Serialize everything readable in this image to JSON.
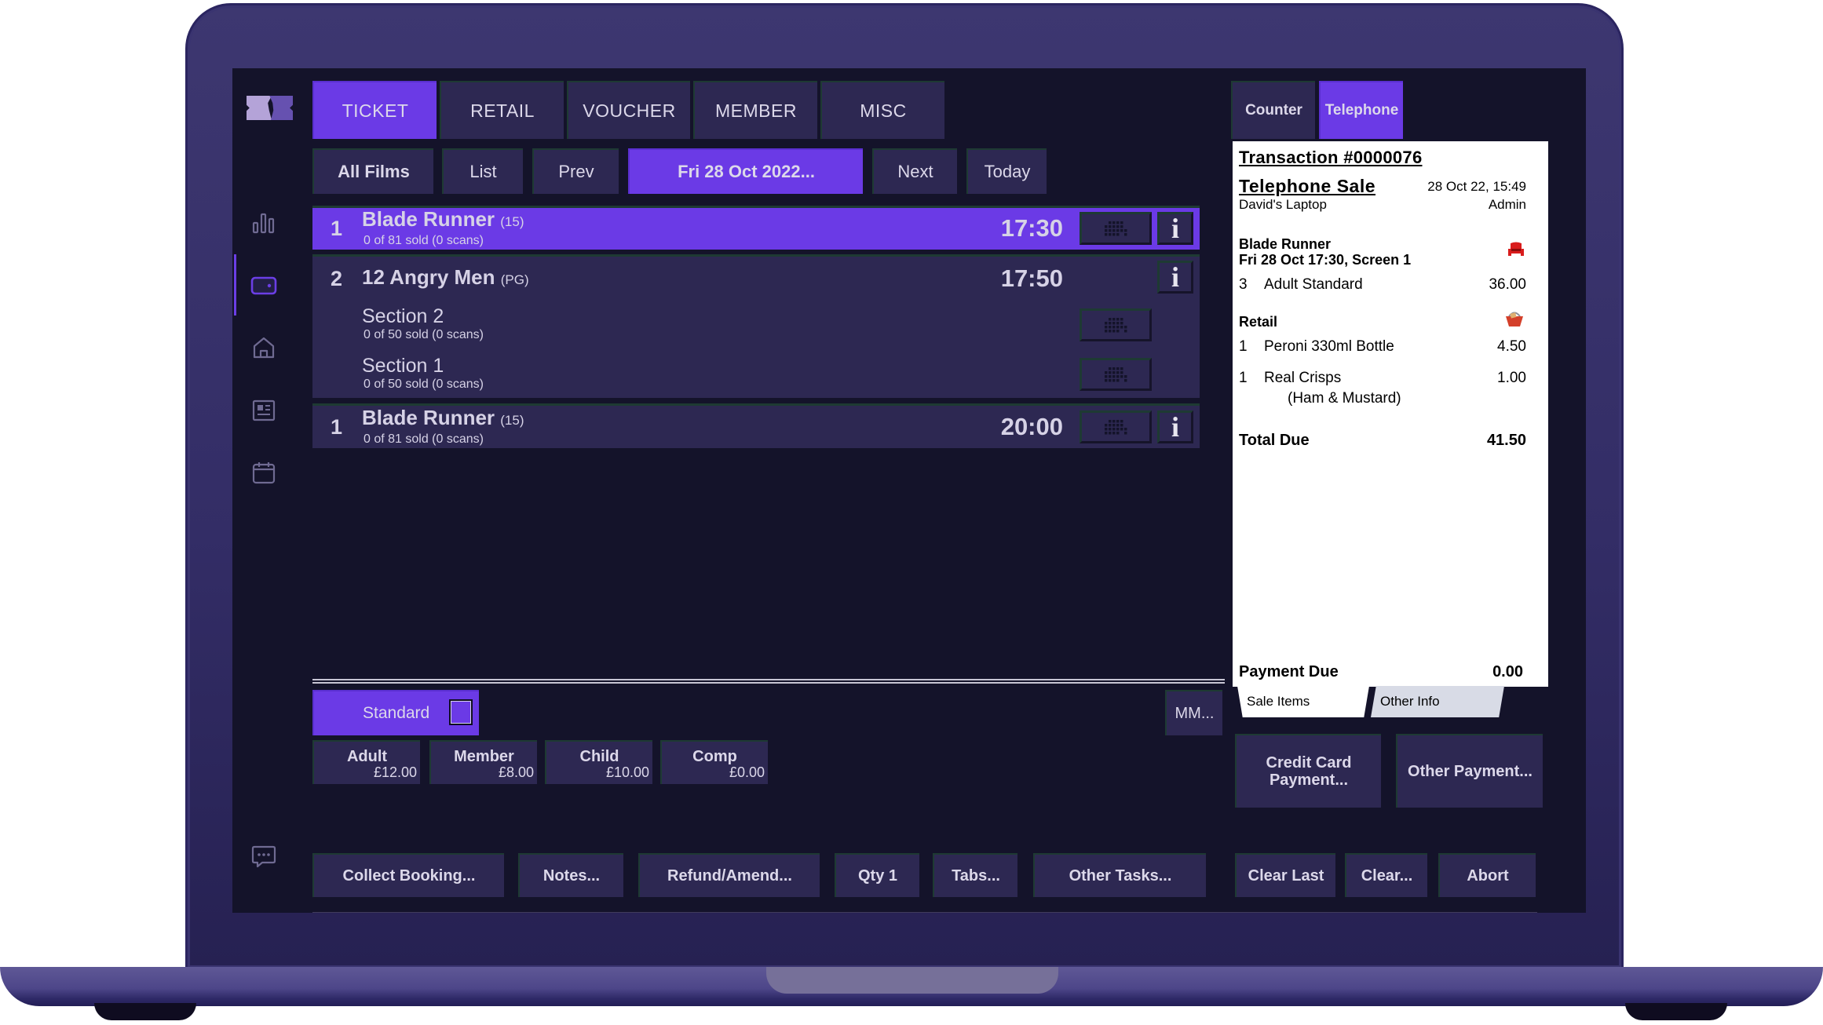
{
  "app": {
    "logo_name": "ticketing-logo"
  },
  "tabs": [
    {
      "label": "TICKET",
      "active": true
    },
    {
      "label": "RETAIL",
      "active": false
    },
    {
      "label": "VOUCHER",
      "active": false
    },
    {
      "label": "MEMBER",
      "active": false
    },
    {
      "label": "MISC",
      "active": false
    }
  ],
  "nav": {
    "all_films": "All Films",
    "list": "List",
    "prev": "Prev",
    "date": "Fri 28 Oct 2022...",
    "next": "Next",
    "today": "Today"
  },
  "sidebar": {
    "items": [
      {
        "icon": "bar-chart-icon",
        "active": false
      },
      {
        "icon": "ticket-card-icon",
        "active": true
      },
      {
        "icon": "home-icon",
        "active": false
      },
      {
        "icon": "newspaper-icon",
        "active": false
      },
      {
        "icon": "calendar-icon",
        "active": false
      }
    ],
    "chat_icon": "chat-bubble-icon"
  },
  "showtimes": [
    {
      "screen": "1",
      "title": "Blade Runner",
      "rating": "(15)",
      "sold": "0 of 81 sold (0 scans)",
      "time": "17:30",
      "selected": true
    },
    {
      "screen": "2",
      "title": "12 Angry Men",
      "rating": "(PG)",
      "time": "17:50",
      "selected": false,
      "sections": [
        {
          "name": "Section 2",
          "sold": "0 of 50 sold (0 scans)"
        },
        {
          "name": "Section 1",
          "sold": "0 of 50 sold (0 scans)"
        }
      ]
    },
    {
      "screen": "1",
      "title": "Blade Runner",
      "rating": "(15)",
      "sold": "0 of 81 sold (0 scans)",
      "time": "20:00",
      "selected": false
    }
  ],
  "info_label": "i",
  "seat_type": {
    "label": "Standard"
  },
  "mm_button": "MM...",
  "prices": [
    {
      "name": "Adult",
      "price": "£12.00"
    },
    {
      "name": "Member",
      "price": "£8.00"
    },
    {
      "name": "Child",
      "price": "£10.00"
    },
    {
      "name": "Comp",
      "price": "£0.00"
    }
  ],
  "bottom_buttons": {
    "collect_booking": "Collect Booking...",
    "notes": "Notes...",
    "refund_amend": "Refund/Amend...",
    "qty": "Qty 1",
    "tabs": "Tabs...",
    "other_tasks": "Other Tasks...",
    "clear_last": "Clear Last",
    "clear": "Clear...",
    "abort": "Abort"
  },
  "sale_mode": {
    "counter": "Counter",
    "telephone": "Telephone",
    "active": "Telephone"
  },
  "receipt": {
    "transaction": "Transaction #0000076",
    "sale_type": "Telephone Sale",
    "datetime": "28 Oct 22, 15:49",
    "terminal": "David's Laptop",
    "user": "Admin",
    "ticket_section": {
      "film": "Blade Runner",
      "showing": "Fri 28 Oct 17:30, Screen 1",
      "lines": [
        {
          "qty": "3",
          "desc": "Adult Standard",
          "amount": "36.00"
        }
      ]
    },
    "retail_section": {
      "heading": "Retail",
      "lines": [
        {
          "qty": "1",
          "desc": "Peroni 330ml Bottle",
          "amount": "4.50"
        },
        {
          "qty": "1",
          "desc": "Real Crisps",
          "sub": "(Ham & Mustard)",
          "amount": "1.00"
        }
      ]
    },
    "total_label": "Total Due",
    "total": "41.50",
    "payment_due_label": "Payment Due",
    "payment_due": "0.00"
  },
  "receipt_tabs": {
    "sale_items": "Sale Items",
    "other_info": "Other Info"
  },
  "payments": {
    "credit_card_line1": "Credit Card",
    "credit_card_line2": "Payment...",
    "other": "Other Payment..."
  },
  "colors": {
    "accent": "#6b3ae6",
    "panel": "#2d2852",
    "background": "#14132a",
    "seat_icon": "#d91c1c"
  }
}
